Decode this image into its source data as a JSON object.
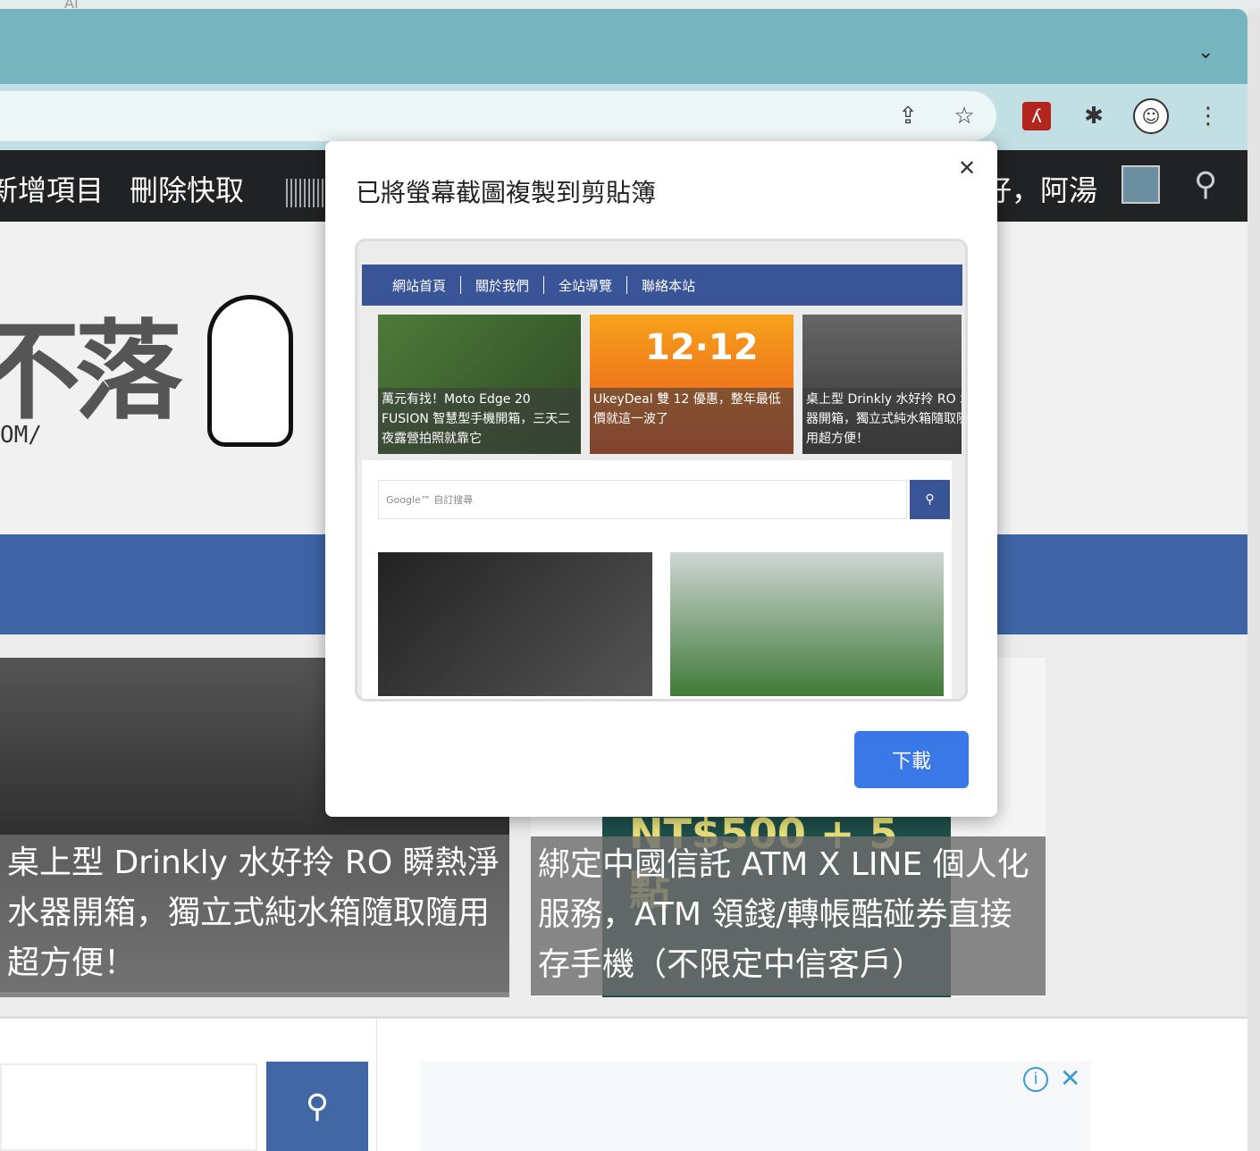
{
  "browser": {
    "top_label": "AI"
  },
  "site_nav": {
    "items": [
      "新增項目",
      "刪除快取"
    ],
    "greeting": "好，阿湯"
  },
  "hero": {
    "logo_text": "不落",
    "url_fragment": "OM/"
  },
  "articles": [
    {
      "title": "桌上型 Drinkly 水好拎 RO 瞬熱淨水器開箱，獨立式純水箱隨取隨用超方便！"
    },
    {
      "title": "綁定中國信託 ATM X LINE 個人化服務，ATM 領錢/轉帳酷碰券直接存手機（不限定中信客戶）"
    }
  ],
  "ad_banner": {
    "text": "NT$500 + 5 點"
  },
  "dialog": {
    "title": "已將螢幕截圖複製到剪貼簿",
    "close_label": "✕",
    "download_label": "下載",
    "preview": {
      "nav": [
        "網站首頁",
        "關於我們",
        "全站導覽",
        "聯絡本站"
      ],
      "cards": [
        {
          "title": "萬元有找！Moto Edge 20 FUSION 智慧型手機開箱，三天二夜露營拍照就靠它"
        },
        {
          "title": "UkeyDeal 雙 12 優惠，整年最低價就這一波了",
          "banner": "12·12"
        },
        {
          "title": "桌上型 Drinkly 水好拎 RO 水器開箱，獨立式純水箱隨取隨用超方便！"
        }
      ],
      "search_placeholder": "Google™ 自訂搜尋"
    }
  },
  "colors": {
    "tabbar": "#76b5bd",
    "toolbar": "#c2e0e3",
    "site_nav": "#202224",
    "band": "#3e64a6",
    "button": "#3b78e7"
  }
}
